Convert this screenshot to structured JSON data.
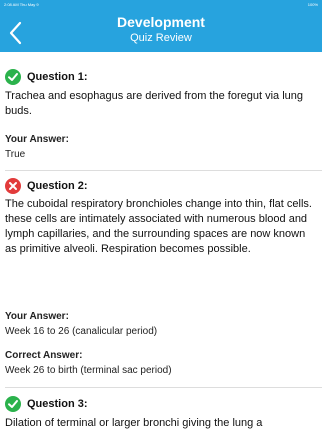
{
  "status_bar": {
    "time": "2:08 AM",
    "date": "Thu May 9",
    "battery": "100%"
  },
  "header": {
    "title": "Development",
    "subtitle": "Quiz Review",
    "back_icon": "chevron-left-icon"
  },
  "questions": [
    {
      "label": "Question 1:",
      "status": "correct",
      "status_color": "#2bb24c",
      "text": "Trachea and esophagus are derived from the foregut via lung buds.",
      "your_answer_label": "Your Answer:",
      "your_answer": "True"
    },
    {
      "label": "Question 2:",
      "status": "incorrect",
      "status_color": "#e23b3b",
      "text": "The cuboidal respiratory bronchioles change into thin, flat cells.  these cells are intimately associated with numerous blood and lymph capillaries, and the surrounding spaces are now known as primitive alveoli.  Respiration becomes possible.",
      "your_answer_label": "Your Answer:",
      "your_answer": "Week 16 to 26 (canalicular period)",
      "correct_answer_label": "Correct Answer:",
      "correct_answer": "Week 26 to birth (terminal sac period)"
    },
    {
      "label": "Question 3:",
      "status": "correct",
      "status_color": "#2bb24c",
      "text": "Dilation of terminal or larger bronchi giving the lung a"
    }
  ]
}
